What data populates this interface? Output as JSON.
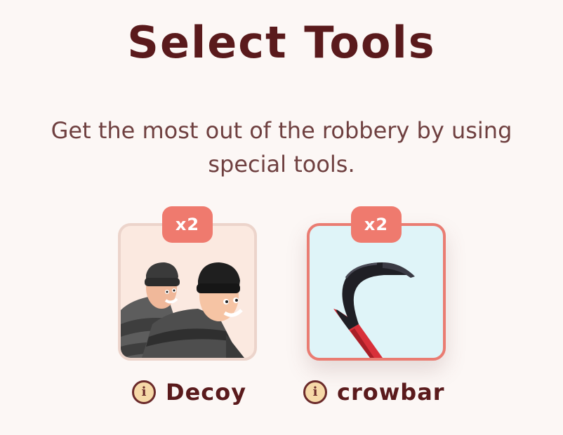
{
  "screen": {
    "title": "Select Tools",
    "subtitle": "Get the most out of the robbery by using special tools."
  },
  "tools": [
    {
      "name": "Decoy",
      "count_label": "x2",
      "icon": "robbers-illustration",
      "selected": false
    },
    {
      "name": "crowbar",
      "count_label": "x2",
      "icon": "crowbar-illustration",
      "selected": true
    }
  ],
  "colors": {
    "title": "#5a1a1c",
    "subtitle": "#6f4040",
    "badge": "#ef7a6e",
    "selected_border": "#ea7c72",
    "card_decoy_bg": "#fbe9e0",
    "card_crowbar_bg": "#dff4f8"
  }
}
